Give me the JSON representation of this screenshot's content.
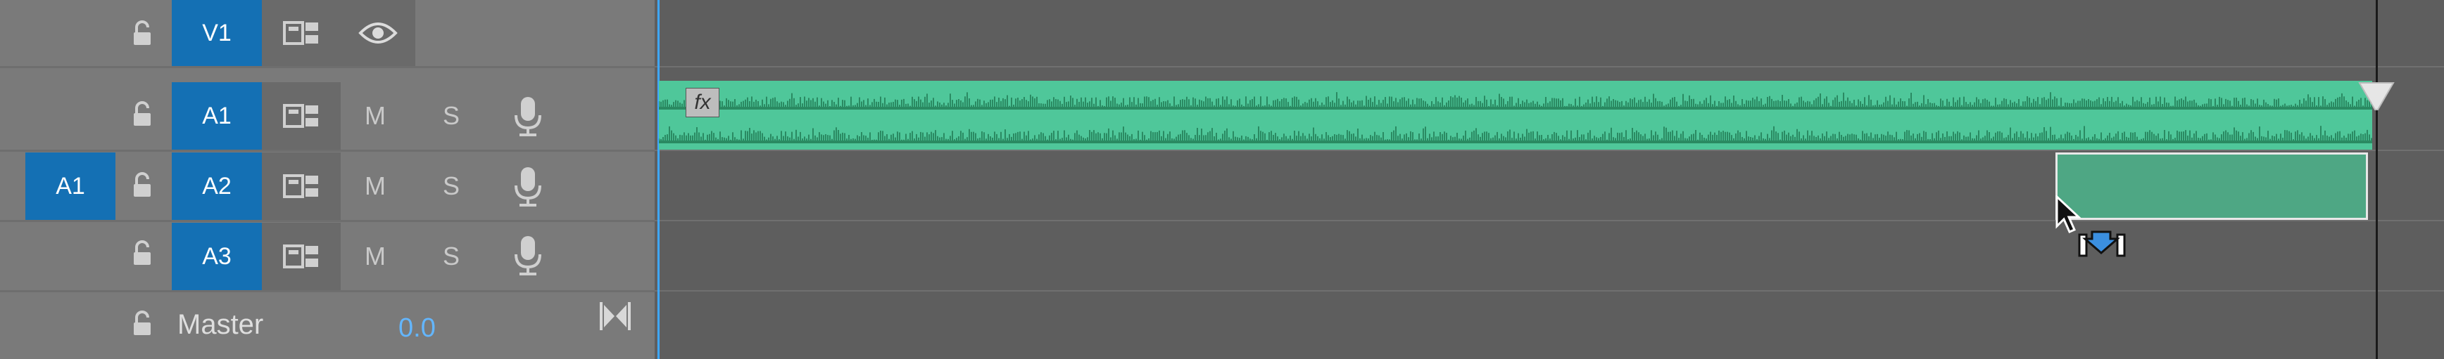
{
  "tracks": {
    "v1": {
      "label": "V1"
    },
    "a1": {
      "label": "A1",
      "mute": "M",
      "solo": "S"
    },
    "a2": {
      "label": "A2",
      "mute": "M",
      "solo": "S",
      "source_patch": "A1"
    },
    "a3": {
      "label": "A3",
      "mute": "M",
      "solo": "S"
    }
  },
  "master": {
    "label": "Master",
    "value": "0.0"
  },
  "clip": {
    "fx_badge": "fx"
  },
  "icons": {
    "lock": "lock-icon",
    "sync": "sync-lock-icon",
    "eye": "eye-icon",
    "mic": "microphone-icon",
    "collapse": "collapse-icon",
    "playhead": "playhead-icon",
    "drag_cursor": "insert-drag-cursor-icon"
  },
  "colors": {
    "header_bg": "#7a7a7a",
    "timeline_bg": "#5e5e5e",
    "accent_blue": "#1470b4",
    "clip_green": "#4fc79a",
    "waveform": "#2a8a62",
    "master_value": "#63b6ff"
  }
}
